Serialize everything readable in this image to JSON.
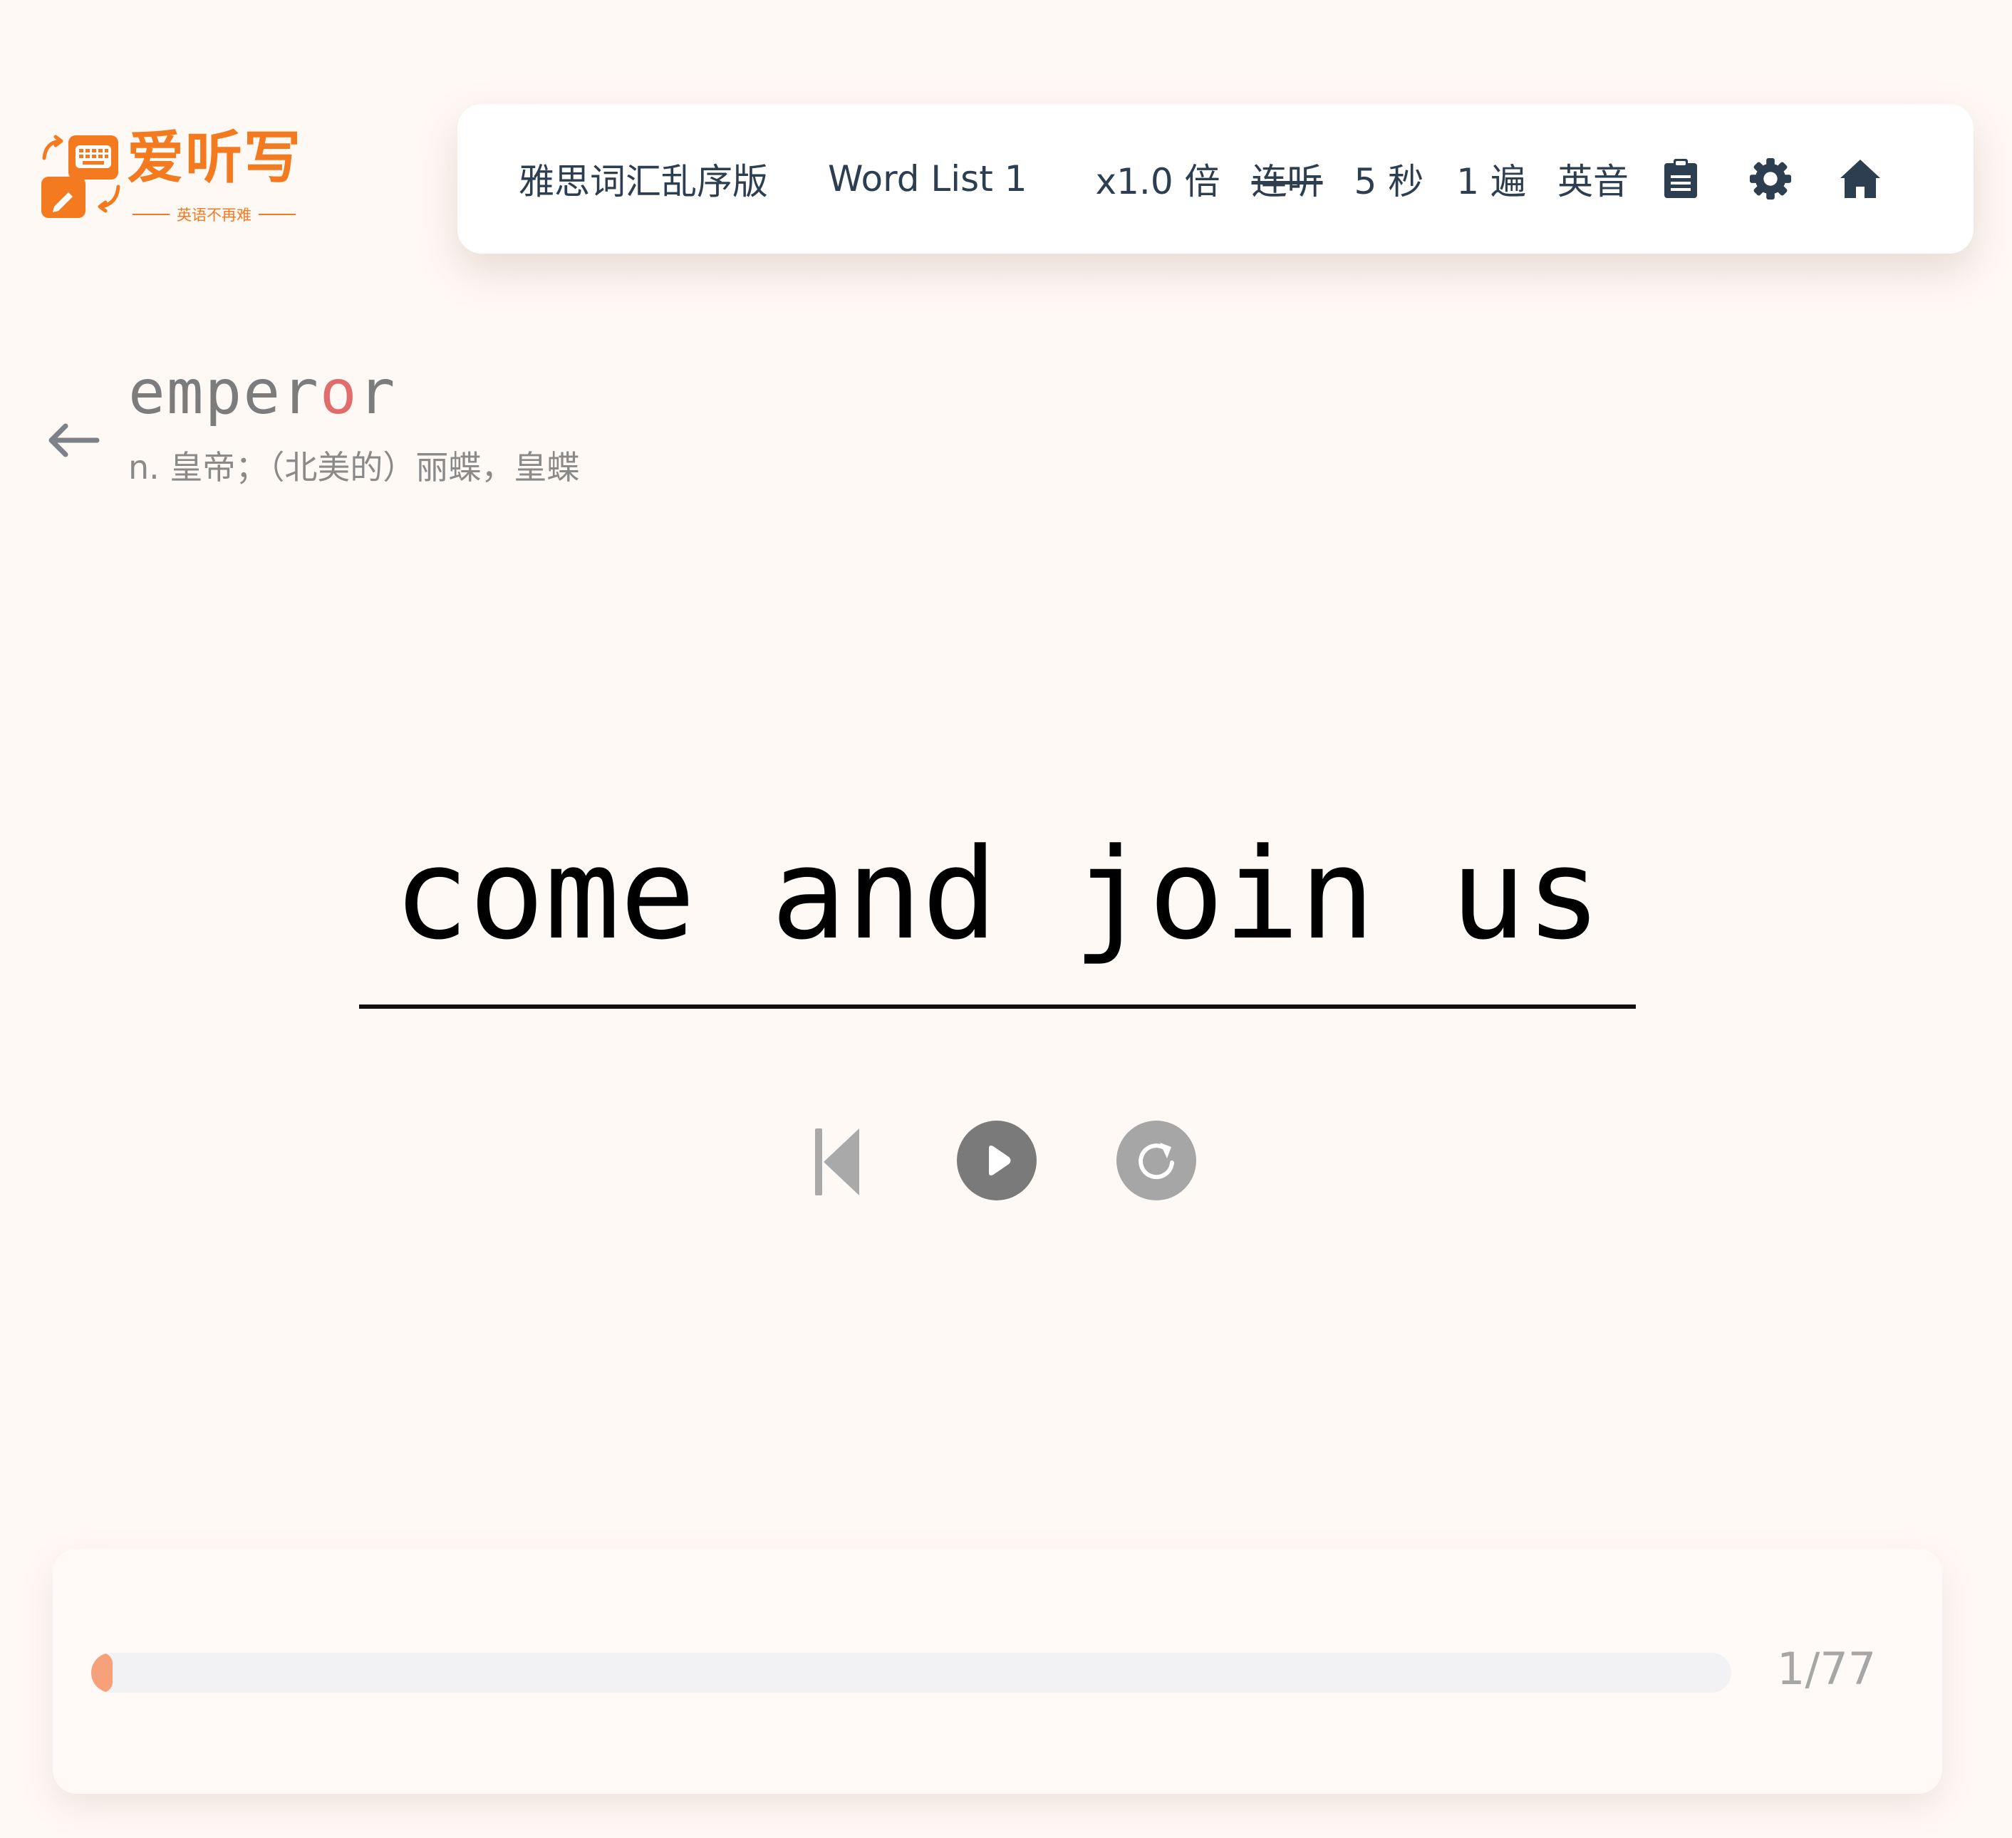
{
  "brand": {
    "title": "爱听写",
    "slogan": "英语不再难",
    "colors": {
      "orange": "#f47a20"
    }
  },
  "toolbar": {
    "book": "雅思词汇乱序版",
    "list": "Word List 1",
    "speed": "x1.0 倍",
    "loop": "连听",
    "interval": "5 秒",
    "repeat": "1 遍",
    "accent": "英音",
    "icons": [
      "clipboard-icon",
      "gear-icon",
      "home-icon"
    ]
  },
  "previous": {
    "word_prefix": "emper",
    "word_wrong": "o",
    "word_suffix": "r",
    "definition": "n. 皇帝；（北美的）丽蝶，皇蝶"
  },
  "current": {
    "sentence": "come and join us"
  },
  "controls": {
    "icons": [
      "skip-back-icon",
      "play-icon",
      "replay-icon"
    ]
  },
  "progress": {
    "count": "1/77",
    "current": 1,
    "total": 77
  }
}
